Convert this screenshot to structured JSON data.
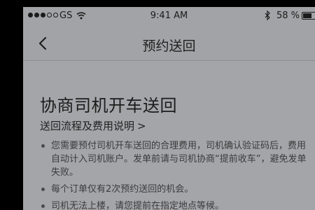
{
  "status_bar": {
    "carrier": "GS",
    "time": "9:41 AM",
    "battery_percent": "58 %",
    "battery_level": 0.58,
    "signal_bars_filled": 3,
    "signal_bars_total": 5,
    "wifi_icon": "wifi-icon",
    "bluetooth_icon": "bluetooth-icon"
  },
  "nav": {
    "back_icon": "chevron-left-icon",
    "title": "预约送回"
  },
  "main": {
    "heading": "协商司机开车送回",
    "flow_link": "送回流程及费用说明",
    "flow_link_chevron": ">",
    "notes": [
      "您需要预付司机开车送回的合理费用，司机确认验证码后，费用自动计入司机账户。发单前请与司机协商“提前收车”，避免发单失败。",
      "每个订单仅有2次预约送回的机会。",
      "司机无法上楼，请您提前在指定地点等候。"
    ]
  },
  "colors": {
    "screen_bg": "#a2a3a6",
    "text_primary": "#1c1c1c",
    "text_secondary": "#3b3b3d",
    "frame": "#000000"
  }
}
